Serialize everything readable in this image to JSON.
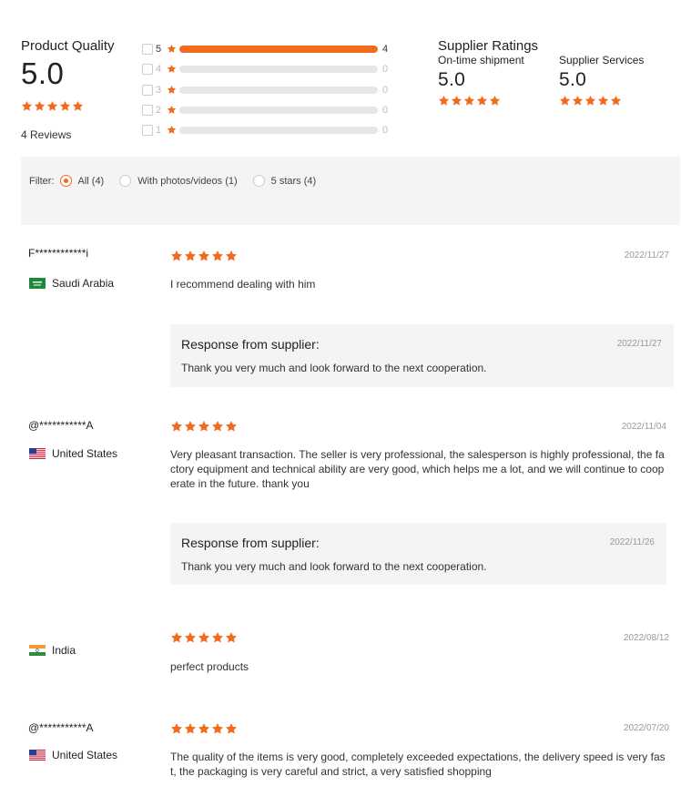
{
  "product_quality": {
    "title": "Product Quality",
    "score": "5.0",
    "stars": 5,
    "reviews_label": "4 Reviews"
  },
  "distribution": [
    {
      "stars": "5",
      "count": "4",
      "fraction": 1.0
    },
    {
      "stars": "4",
      "count": "0",
      "fraction": 0
    },
    {
      "stars": "3",
      "count": "0",
      "fraction": 0
    },
    {
      "stars": "2",
      "count": "0",
      "fraction": 0
    },
    {
      "stars": "1",
      "count": "0",
      "fraction": 0
    }
  ],
  "supplier_ratings": {
    "title": "Supplier Ratings",
    "shipment_label": "On-time shipment",
    "shipment_score": "5.0",
    "services_label": "Supplier Services",
    "services_score": "5.0"
  },
  "filter": {
    "label": "Filter:",
    "options": [
      {
        "label": "All (4)",
        "selected": true
      },
      {
        "label": "With photos/videos (1)",
        "selected": false
      },
      {
        "label": "5 stars (4)",
        "selected": false
      }
    ]
  },
  "reviews": [
    {
      "name": "F************i",
      "country": "Saudi Arabia",
      "flag": "saudi-arabia",
      "stars": 5,
      "date": "2022/11/27",
      "text": "I recommend dealing with him",
      "response": {
        "title": "Response from supplier:",
        "date": "2022/11/27",
        "text": "Thank you very much and look forward to the next cooperation."
      }
    },
    {
      "name": "@***********A",
      "country": "United States",
      "flag": "united-states",
      "stars": 5,
      "date": "2022/11/04",
      "text": "Very pleasant transaction. The seller is very professional, the salesperson is highly professional, the factory equipment and technical ability are very good, which helps me a lot, and we will continue to cooperate in the future. thank you",
      "response": {
        "title": "Response from supplier:",
        "date": "2022/11/26",
        "text": "Thank you very much and look forward to the next cooperation."
      }
    },
    {
      "name": "",
      "country": "India",
      "flag": "india",
      "stars": 5,
      "date": "2022/08/12",
      "text": "perfect products"
    },
    {
      "name": "@***********A",
      "country": "United States",
      "flag": "united-states",
      "stars": 5,
      "date": "2022/07/20",
      "text": "The quality of the items is very good, completely exceeded expectations, the delivery speed is very fast, the packaging is very careful and strict, a very satisfied shopping"
    }
  ],
  "colors": {
    "accent": "#f26b1d",
    "bar_bg": "#e6e6e6",
    "panel_bg": "#f4f4f4"
  }
}
